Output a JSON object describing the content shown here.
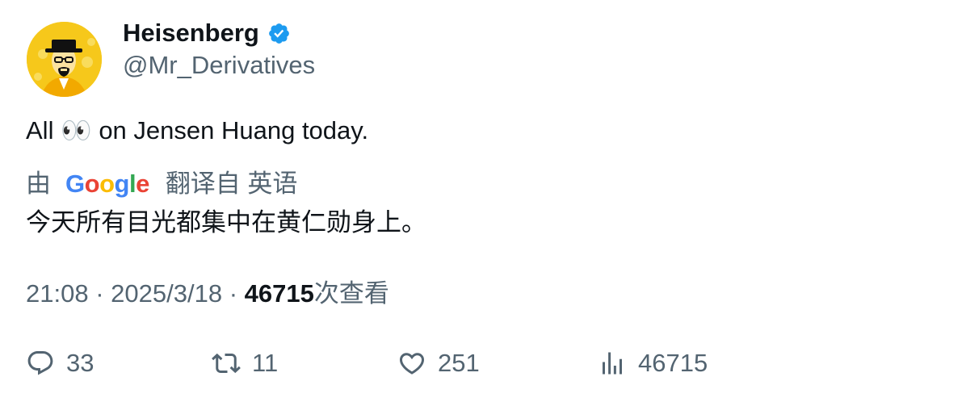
{
  "author": {
    "display_name": "Heisenberg",
    "handle": "@Mr_Derivatives",
    "avatar_icon": "heisenberg-avatar-icon",
    "verified_color": "#1d9bf0"
  },
  "tweet": {
    "text_before": "All",
    "emoji": "👀",
    "text_after": "on Jensen Huang today."
  },
  "translation": {
    "prefix": "由",
    "provider": "Google",
    "suffix": "翻译自 英语",
    "translated_text": "今天所有目光都集中在黄仁勋身上。"
  },
  "meta": {
    "time": "21:08",
    "separator": "·",
    "date": "2025/3/18",
    "views_count": "46715",
    "views_label": "次查看"
  },
  "actions": {
    "replies": "33",
    "retweets": "11",
    "likes": "251",
    "views": "46715"
  },
  "colors": {
    "text_primary": "#0f1419",
    "text_secondary": "#536471",
    "avatar_bg": "#f6c81b"
  }
}
